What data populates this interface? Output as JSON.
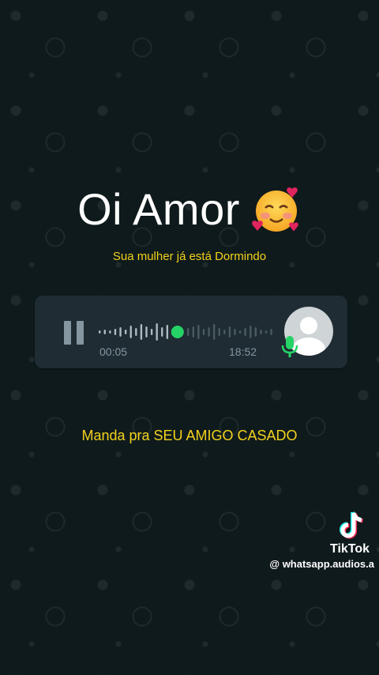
{
  "title": "Oi Amor",
  "title_emoji": "smiling-face-with-hearts",
  "subtitle": "Sua mulher já está Dormindo",
  "audio_message": {
    "elapsed": "00:05",
    "time_sent": "18:52",
    "progress": 0.45,
    "icons": {
      "pause": "pause-icon",
      "avatar": "default-avatar-icon",
      "mic": "microphone-icon"
    },
    "accent_color": "#25d366"
  },
  "cta": "Manda pra SEU AMIGO CASADO",
  "watermark": {
    "brand": "TikTok",
    "handle": "@ whatsapp.audios.a"
  },
  "colors": {
    "highlight_text": "#f2d21c",
    "background": "#0f1a1c",
    "card": "#1f2c33"
  }
}
